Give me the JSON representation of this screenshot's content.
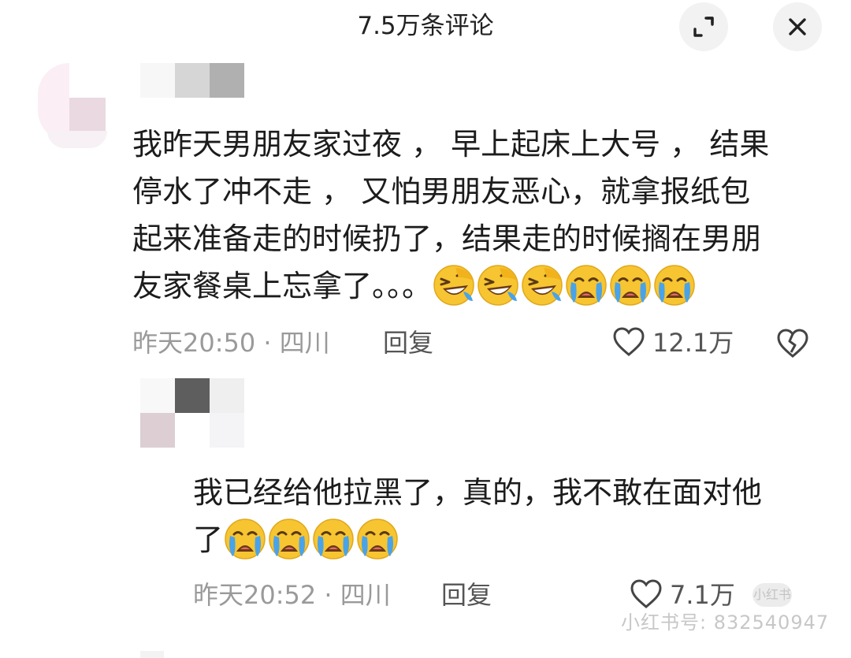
{
  "header": {
    "title": "7.5万条评论"
  },
  "comments": [
    {
      "text_lines": [
        "我昨天男朋友家过夜 ， 早上起床上大号 ， 结果",
        "停水了冲不走 ， 又怕男朋友恶心，就拿报纸包",
        "起来准备走的时候扔了，结果走的时候搁在男朋",
        "友家餐桌上忘拿了。。。"
      ],
      "emojis": [
        "laughing-cry-icon",
        "laughing-cry-icon",
        "laughing-cry-icon",
        "crying-icon",
        "crying-icon",
        "crying-icon"
      ],
      "meta": "昨天20:50 · 四川",
      "reply_label": "回复",
      "likes": "12.1万"
    },
    {
      "text_lines": [
        "我已经给他拉黑了，真的，我不敢在面对他",
        "了"
      ],
      "emojis": [
        "crying-icon",
        "crying-icon",
        "crying-icon",
        "crying-icon"
      ],
      "meta": "昨天20:52 · 四川",
      "reply_label": "回复",
      "likes": "7.1万"
    }
  ],
  "watermark": {
    "text": "小红书号: 832540947",
    "logo": "小红书"
  },
  "colors": {
    "emoji_yellow": "#f7c531",
    "tear_blue": "#4aa3e8",
    "muted_text": "#9a9a9a"
  }
}
